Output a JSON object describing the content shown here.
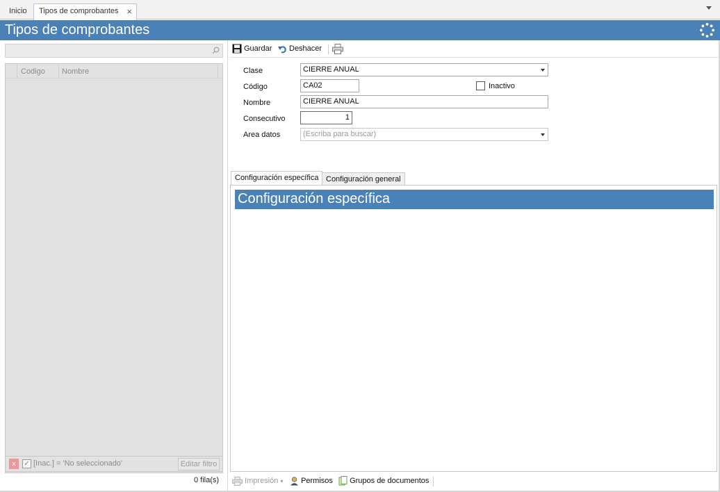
{
  "tabs": {
    "home": "Inicio",
    "active": "Tipos de comprobantes",
    "close_glyph": "×"
  },
  "title": "Tipos de comprobantes",
  "left": {
    "search_placeholder": "",
    "columns": [
      "Codigo",
      "Nombre"
    ],
    "filter_x": "x",
    "filter_check": "✓",
    "filter_text": "[Inac.] = 'No seleccionado'",
    "edit_filter": "Editar filtro",
    "row_count": "0 fila(s)"
  },
  "toolbar": {
    "save": "Guardar",
    "undo": "Deshacer",
    "save_icon": "floppy-icon",
    "undo_icon": "undo-icon",
    "print_icon": "printer-icon"
  },
  "form": {
    "clase_label": "Clase",
    "clase_value": "CIERRE ANUAL",
    "codigo_label": "Código",
    "codigo_value": "CA02",
    "inactivo_label": "Inactivo",
    "nombre_label": "Nombre",
    "nombre_value": "CIERRE ANUAL",
    "consecutivo_label": "Consecutivo",
    "consecutivo_value": "1",
    "area_label": "Area datos",
    "area_placeholder": "(Escriba para buscar)"
  },
  "inner_tabs": {
    "specific": "Configuración específica",
    "general": "Configuración general"
  },
  "section_title": "Configuración específica",
  "bottom": {
    "print": "Impresión",
    "permissions": "Permisos",
    "groups": "Grupos de documentos"
  },
  "colors": {
    "accent": "#4a82b7",
    "tab_border": "#b9c7d6"
  }
}
